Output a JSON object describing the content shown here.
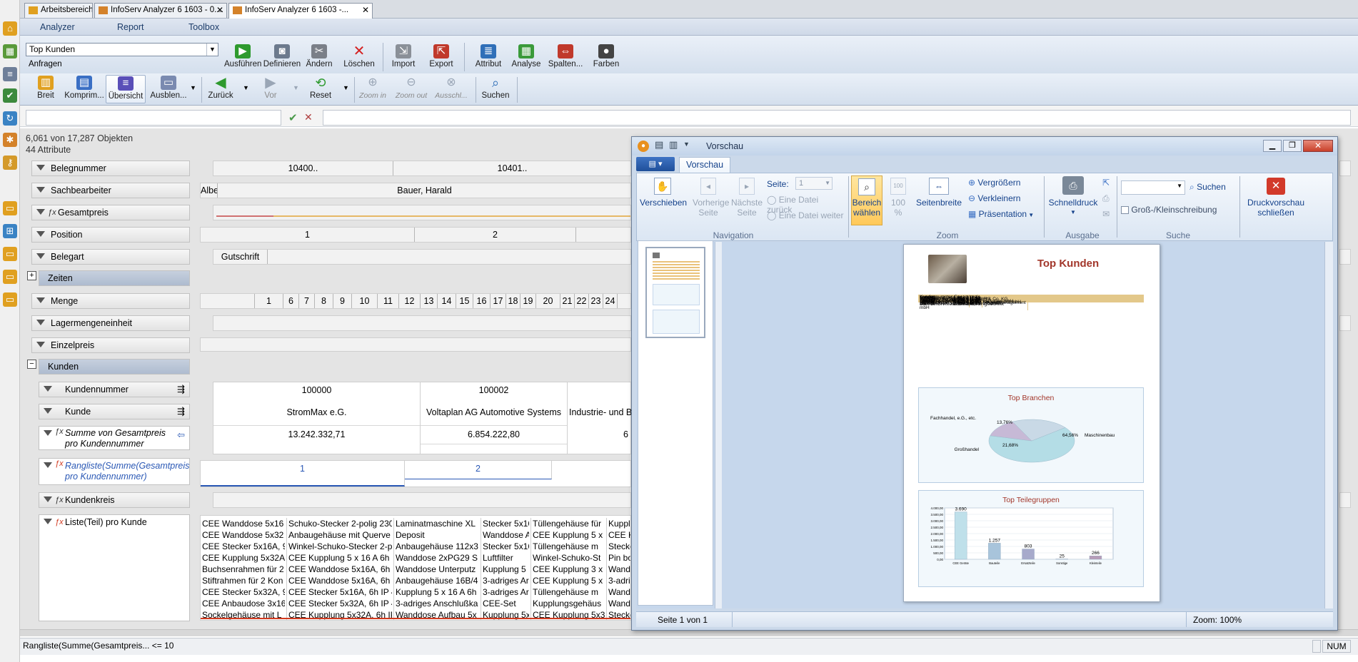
{
  "tabs": [
    {
      "label": "Arbeitsbereich"
    },
    {
      "label": "InfoServ Analyzer 6 1603 - 0...."
    },
    {
      "label": "InfoServ Analyzer 6 1603 -..."
    }
  ],
  "menu": [
    "Analyzer",
    "Report",
    "Toolbox"
  ],
  "query": {
    "selected": "Top Kunden",
    "group_label": "Anfragen"
  },
  "toolbar1": [
    "Ausführen",
    "Definieren",
    "Ändern",
    "Löschen",
    "Import",
    "Export",
    "Attribut",
    "Analyse",
    "Spalten...",
    "Farben"
  ],
  "toolbar2": [
    "Breit",
    "Komprim...",
    "Übersicht",
    "Ausblen...",
    "Zurück",
    "Vor",
    "Reset",
    "Zoom in",
    "Zoom out",
    "Ausschl...",
    "Suchen"
  ],
  "counts": {
    "objects": "6,061 von 17,287 Objekten",
    "attributes": "44 Attribute"
  },
  "attributes": {
    "belegnummer": "Belegnummer",
    "sachbearbeiter": "Sachbearbeiter",
    "gesamtpreis": "Gesamtpreis",
    "position": "Position",
    "belegart": "Belegart",
    "zeiten": "Zeiten",
    "menge": "Menge",
    "lagermengeneinheit": "Lagermengeneinheit",
    "einzelpreis": "Einzelpreis",
    "kunden": "Kunden",
    "kundennummer": "Kundennummer",
    "kunde": "Kunde",
    "summe": "Summe von Gesamtpreis pro Kundennummer",
    "rangliste": "Rangliste(Summe(Gesamtpreis pro Kundennummer)",
    "kundenkreis": "Kundenkreis",
    "liste": "Liste(Teil) pro Kunde"
  },
  "values": {
    "belegnummer": [
      "10400..",
      "10401.."
    ],
    "sachbearbeiter": [
      "Albe",
      "Bauer, Harald"
    ],
    "position": [
      "1",
      "2"
    ],
    "belegart": [
      "Gutschrift"
    ],
    "menge": [
      "1",
      "6",
      "7",
      "8",
      "9",
      "10",
      "11",
      "12",
      "13",
      "14",
      "15",
      "16",
      "17",
      "18",
      "19",
      "20",
      "21",
      "22",
      "23",
      "24"
    ],
    "kunden_cols": [
      {
        "nr": "100000",
        "name": "StromMax e.G.",
        "sum": "13.242.332,71"
      },
      {
        "nr": "100002",
        "name": "Voltaplan AG Automotive Systems",
        "sum": "6.854.222,80"
      },
      {
        "nr": "",
        "name": "Industrie- und B",
        "sum": "6"
      }
    ],
    "rangliste": [
      "1",
      "2"
    ]
  },
  "liste_cols": [
    [
      "CEE Wanddose 5x16",
      "CEE Wanddose 5x32",
      "CEE Stecker 5x16A, 9",
      "CEE Kupplung 5x32A",
      "Buchsenrahmen für 2",
      "Stiftrahmen für 2 Kon",
      "CEE Stecker 5x32A, 9",
      "CEE Anbaudose 3x16",
      "Sockelgehäuse mit L"
    ],
    [
      "Schuko-Stecker 2-polig 230",
      "Anbaugehäuse mit Querve",
      "Winkel-Schuko-Stecker 2-p",
      "CEE Kupplung 5 x 16 A 6h",
      "CEE Wanddose 5x16A, 6h",
      "CEE Wanddose 5x16A, 6h",
      "CEE Stecker 5x16A, 6h IP 4",
      "CEE Stecker 5x32A, 6h IP 4",
      "CEE Kupplung 5x32A, 6h IP"
    ],
    [
      "Laminatmaschine XL",
      "Deposit",
      "Anbaugehäuse 112x3",
      "Wanddose 2xPG29 S",
      "Wanddose Unterputz",
      "Anbaugehäuse 16B/4",
      "Kupplung 5 x 16 A 6h",
      "3-adriges Anschlußka",
      "Wanddose Aufbau 5x"
    ],
    [
      "Stecker 5x16",
      "Wanddose A",
      "Stecker 5x16",
      "Luftfilter",
      "Kupplung 5",
      "3-adriges Ar",
      "3-adriges Ar",
      "CEE-Set",
      "Kupplung 5x"
    ],
    [
      "Tüllengehäuse für",
      "CEE Kupplung 5 x",
      "Tüllengehäuse m",
      "Winkel-Schuko-St",
      "CEE Kupplung 3 x",
      "CEE Kupplung 5 x",
      "Tüllengehäuse m",
      "Kupplungsgehäus",
      "CEE Kupplung 5x32A,"
    ],
    [
      "Kupplun",
      "CEE Kupp",
      "Stecker",
      "Pin boa",
      "Wanddo",
      "3-adrige",
      "Wanddo",
      "Wanddo",
      "Stecker"
    ]
  ],
  "statusbar": {
    "left": "Rangliste(Summe(Gesamtpreis... <= 10",
    "num": "NUM"
  },
  "preview": {
    "title": "Vorschau",
    "tab": "Vorschau",
    "buttons": {
      "verschieben": "Verschieben",
      "vorherige": "Vorherige Seite",
      "naechste": "Nächste Seite",
      "seite_label": "Seite:",
      "seite_value": "1",
      "datei_zurueck": "Eine Datei zurück",
      "datei_weiter": "Eine Datei weiter",
      "bereich": "Bereich wählen",
      "hundert": "100 %",
      "seitenbreite": "Seitenbreite",
      "vergroessern": "Vergrößern",
      "verkleinern": "Verkleinern",
      "praesentation": "Präsentation",
      "schnelldruck": "Schnelldruck",
      "suchen": "Suchen",
      "gross_klein": "Groß-/Kleinschreibung",
      "schliessen": "Druckvorschau schließen"
    },
    "groups": [
      "Navigation",
      "Zoom",
      "Ausgabe",
      "Suche"
    ],
    "status_left": "Seite 1 von 1",
    "status_right": "Zoom: 100%"
  },
  "report": {
    "title": "Top Kunden",
    "table_headers": [
      "Kundennummer",
      "Kunde",
      "Gesamtpreis"
    ],
    "rows": [
      [
        "100000",
        "StromMax e.G.",
        "13.242.332,71"
      ],
      [
        "100002",
        "Voltaplan AG Automotive Systems",
        "6.854.222,80"
      ],
      [
        "100003",
        "Industrie- und Bürobedarf GmbH & Co. KG",
        "6.668.667,00"
      ],
      [
        "101001",
        "Teamwork Baumarkt Esslingen",
        "4.705.144,42"
      ],
      [
        "110001",
        "Heindl Maschinen Ges.mbH",
        "4.364.105,00"
      ],
      [
        "110000",
        "Stecker Austria Import und Handels Ges.mbH",
        "3.802.495,70"
      ],
      [
        "100001",
        "Ronnenberger Ges. für Projektmanagement mbH",
        "3.694.850,60"
      ],
      [
        "100008",
        "Ronnenberger Gesellschaft für Projektmanagement mbH",
        "3.622.936,30"
      ],
      [
        "100005",
        "Elektro Müller GmbH Elektrofachhandel",
        "3.410.843,54"
      ],
      [
        "100004",
        "MBT GmbH Mosel Beschichtungstechnik",
        "3.185.896,70"
      ]
    ],
    "pie_title": "Top Branchen",
    "bar_title": "Top Teilegruppen"
  },
  "chart_data": [
    {
      "type": "pie",
      "title": "Top Branchen",
      "categories": [
        "Maschinenbau",
        "Fachhandel, e.G., etc.",
        "Großhandel"
      ],
      "values": [
        64.56,
        13.76,
        21.68
      ],
      "value_labels": [
        "64,56%",
        "13,76%",
        "21,68%"
      ]
    },
    {
      "type": "bar",
      "title": "Top Teilegruppen",
      "categories": [
        "CEE Geräte",
        "Bauteile",
        "Ersatzteile",
        "Sonstige",
        "Kleinteile"
      ],
      "values": [
        3690,
        1257,
        803,
        25,
        266
      ],
      "value_labels": [
        "3.690",
        "1.257",
        "803",
        "25",
        "266"
      ],
      "y_ticks": [
        "4.000,00",
        "3.500,00",
        "3.000,00",
        "2.500,00",
        "2.000,00",
        "1.500,00",
        "1.000,00",
        "500,00",
        "0,00"
      ],
      "ylim": [
        0,
        4000
      ]
    }
  ],
  "colors": {
    "accent": "#1d3d6a",
    "filter_red": "#d23a1f",
    "rank_blue": "#2a58b5",
    "report_title": "#a2362a"
  }
}
